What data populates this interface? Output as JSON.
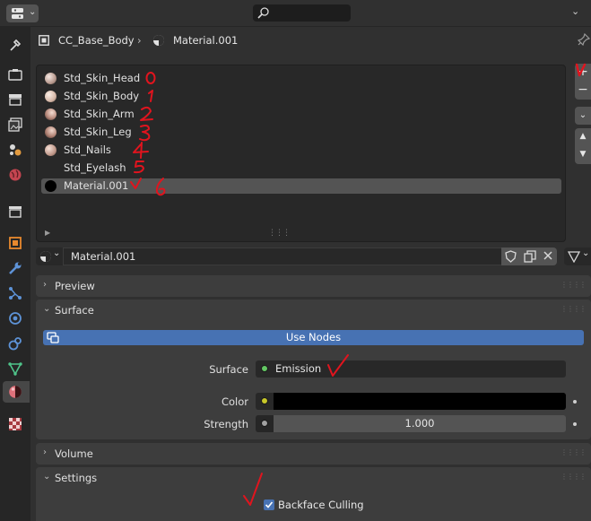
{
  "header": {
    "editor_type_icon": "properties-editor-icon",
    "search_icon": "search-icon"
  },
  "tabs": [
    {
      "name": "tool",
      "icon": "tool-icon"
    },
    {
      "name": "render",
      "icon": "render-icon"
    },
    {
      "name": "output",
      "icon": "output-icon"
    },
    {
      "name": "view-layer",
      "icon": "view-layer-icon"
    },
    {
      "name": "scene",
      "icon": "scene-icon"
    },
    {
      "name": "world",
      "icon": "world-icon"
    },
    {
      "name": "collection",
      "icon": "collection-icon"
    },
    {
      "name": "object",
      "icon": "object-icon"
    },
    {
      "name": "modifiers",
      "icon": "wrench-icon"
    },
    {
      "name": "particles",
      "icon": "particles-icon"
    },
    {
      "name": "physics",
      "icon": "physics-icon"
    },
    {
      "name": "constraints",
      "icon": "constraints-icon"
    },
    {
      "name": "data",
      "icon": "mesh-data-icon"
    },
    {
      "name": "material",
      "icon": "material-icon",
      "active": true
    },
    {
      "name": "texture",
      "icon": "texture-icon"
    }
  ],
  "breadcrumb": {
    "object": "CC_Base_Body",
    "material": "Material.001"
  },
  "material_slots": [
    {
      "name": "Std_Skin_Head",
      "annotation": "0",
      "color": "#d8c2b8"
    },
    {
      "name": "Std_Skin_Body",
      "annotation": "1",
      "color": "#e3cbbd"
    },
    {
      "name": "Std_Skin_Arm",
      "annotation": "2",
      "color": "#caa597"
    },
    {
      "name": "Std_Skin_Leg",
      "annotation": "3",
      "color": "#c79e90"
    },
    {
      "name": "Std_Nails",
      "annotation": "4",
      "color": "#d0aca0"
    },
    {
      "name": "Std_Eyelash",
      "annotation": "5",
      "color": ""
    },
    {
      "name": "Material.001",
      "annotation": "6",
      "color": "#000000",
      "selected": true
    }
  ],
  "material_selector": {
    "name": "Material.001"
  },
  "panels": {
    "preview": {
      "title": "Preview",
      "expanded": false
    },
    "surface": {
      "title": "Surface",
      "expanded": true,
      "use_nodes_label": "Use Nodes",
      "surface_label": "Surface",
      "surface_value": "Emission",
      "surface_socket_color": "#63c763",
      "color_label": "Color",
      "color_value": "#000000",
      "color_socket_color": "#c7c729",
      "strength_label": "Strength",
      "strength_value": "1.000",
      "strength_socket_color": "#a1a1a1"
    },
    "volume": {
      "title": "Volume",
      "expanded": false
    },
    "settings": {
      "title": "Settings",
      "expanded": true,
      "backface_culling_label": "Backface Culling",
      "backface_culling_checked": true
    }
  },
  "colors": {
    "accent": "#4772b3",
    "annotation_ink": "#e0141e"
  }
}
